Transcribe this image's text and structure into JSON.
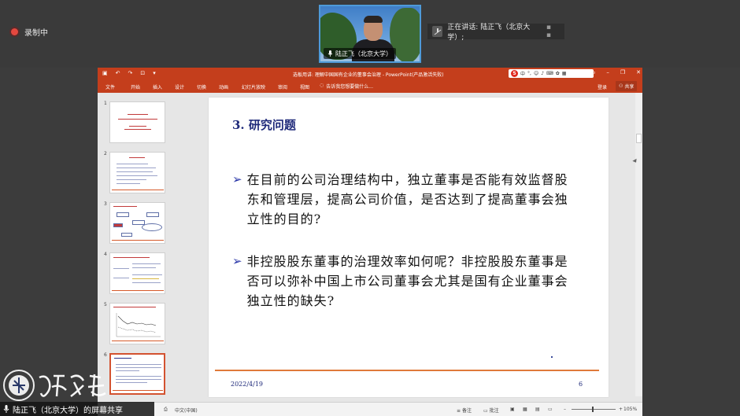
{
  "meeting": {
    "recording_label": "录制中",
    "participant_name": "陆正飞（北京大学）",
    "speaking_label": "正在讲话: 陆正飞（北京大学）;",
    "share_banner": "陆正飞（北京大学）的屏幕共享"
  },
  "ppt": {
    "doc_title": "选板用讲: 理解中国国有企业的董事会治理 - PowerPoint(产品激活失败)",
    "tabs": [
      "文件",
      "开始",
      "插入",
      "设计",
      "切换",
      "动画",
      "幻灯片放映",
      "审阅",
      "视图"
    ],
    "tell_me": "告诉我您想要做什么...",
    "login": "登录",
    "share": "共享",
    "sogou_label": "中",
    "thumb_numbers": [
      "1",
      "2",
      "3",
      "4",
      "5",
      "6"
    ],
    "status_lang": "中文(中国)",
    "status_notes": "备注",
    "status_comments": "批注",
    "status_zoom": "105%"
  },
  "slide": {
    "title": "3. 研究问题",
    "bullet1": "在目前的公司治理结构中，独立董事是否能有效监督股东和管理层，提高公司价值，是否达到了提高董事会独立性的目的?",
    "bullet2": "非控股股东董事的治理效率如何呢？非控股股东董事是否可以弥补中国上市公司董事会尤其是国有企业董事会独立性的缺失?",
    "date": "2022/4/19",
    "page": "6"
  },
  "logo": {
    "text": "復旦大學"
  },
  "colors": {
    "ppt_accent": "#c43e1c",
    "slide_title": "#1f2a7a",
    "rule": "#e07a3a"
  }
}
